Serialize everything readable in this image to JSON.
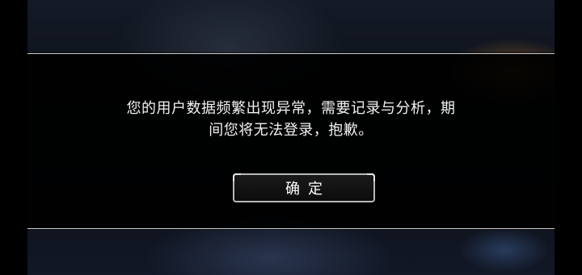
{
  "dialog": {
    "message_line1": "您的用户数据频繁出现异常，需要记录与分析，期",
    "message_line2": "间您将无法登录，抱歉。",
    "confirm_label": "确定"
  }
}
